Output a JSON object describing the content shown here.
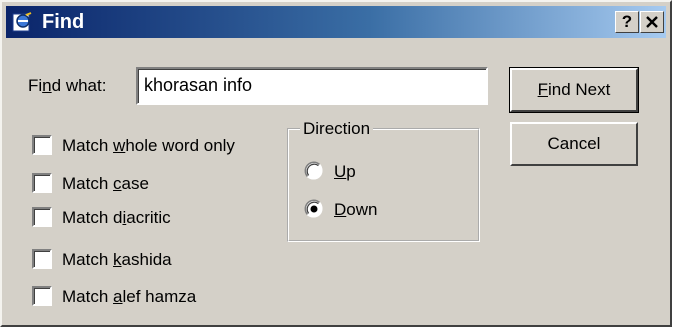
{
  "window": {
    "title": "Find",
    "help_label": "?",
    "icon": "ie-find-icon"
  },
  "find": {
    "label_pre": "Fi",
    "label_mnemonic": "n",
    "label_post": "d what:",
    "value": "khorasan info"
  },
  "buttons": {
    "find_next": {
      "mnemonic": "F",
      "rest": "ind Next"
    },
    "cancel": "Cancel"
  },
  "options": [
    {
      "pre": "Match ",
      "mnemonic": "w",
      "post": "hole word only",
      "checked": false
    },
    {
      "pre": "Match ",
      "mnemonic": "c",
      "post": "ase",
      "checked": false
    },
    {
      "pre": "Match d",
      "mnemonic": "i",
      "post": "acritic",
      "checked": false
    },
    {
      "pre": "Match ",
      "mnemonic": "k",
      "post": "ashida",
      "checked": false
    },
    {
      "pre": "Match ",
      "mnemonic": "a",
      "post": "lef hamza",
      "checked": false
    }
  ],
  "direction": {
    "legend": "Direction",
    "up": {
      "mnemonic": "U",
      "rest": "p",
      "selected": false
    },
    "down": {
      "mnemonic": "D",
      "rest": "own",
      "selected": true
    }
  },
  "colors": {
    "title_start": "#0a246a",
    "title_end": "#a6caf0",
    "face": "#d4d0c8"
  }
}
